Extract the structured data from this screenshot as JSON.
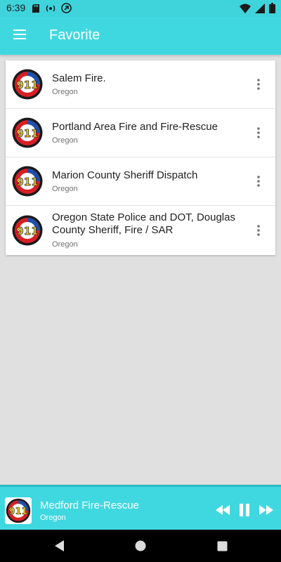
{
  "status_bar": {
    "time": "6:39",
    "icons": [
      "sd-card-icon",
      "dnd-icon",
      "cast-icon",
      "wifi-icon",
      "signal-icon",
      "battery-icon"
    ]
  },
  "app_bar": {
    "title": "Favorite",
    "menu_icon": "menu-icon",
    "background": "#40d8e0"
  },
  "favorites": [
    {
      "title": "Salem Fire.",
      "subtitle": "Oregon"
    },
    {
      "title": "Portland Area Fire and Fire-Rescue",
      "subtitle": "Oregon"
    },
    {
      "title": "Marion County Sheriff Dispatch",
      "subtitle": "Oregon"
    },
    {
      "title": "Oregon State Police and DOT, Douglas County Sheriff, Fire / SAR",
      "subtitle": "Oregon"
    }
  ],
  "logo": {
    "number": "911",
    "top_text": "FIRE EMS POLICE",
    "bottom_text": "DISPATCH"
  },
  "player": {
    "title": "Medford Fire-Rescue",
    "subtitle": "Oregon",
    "controls": [
      "rewind-icon",
      "pause-icon",
      "fast-forward-icon"
    ]
  },
  "nav_bar": {
    "buttons": [
      "back-icon",
      "home-icon",
      "recents-icon"
    ]
  },
  "colors": {
    "accent": "#40d8e0",
    "player_border": "#2ab9c2",
    "background": "#e0e0e0"
  }
}
